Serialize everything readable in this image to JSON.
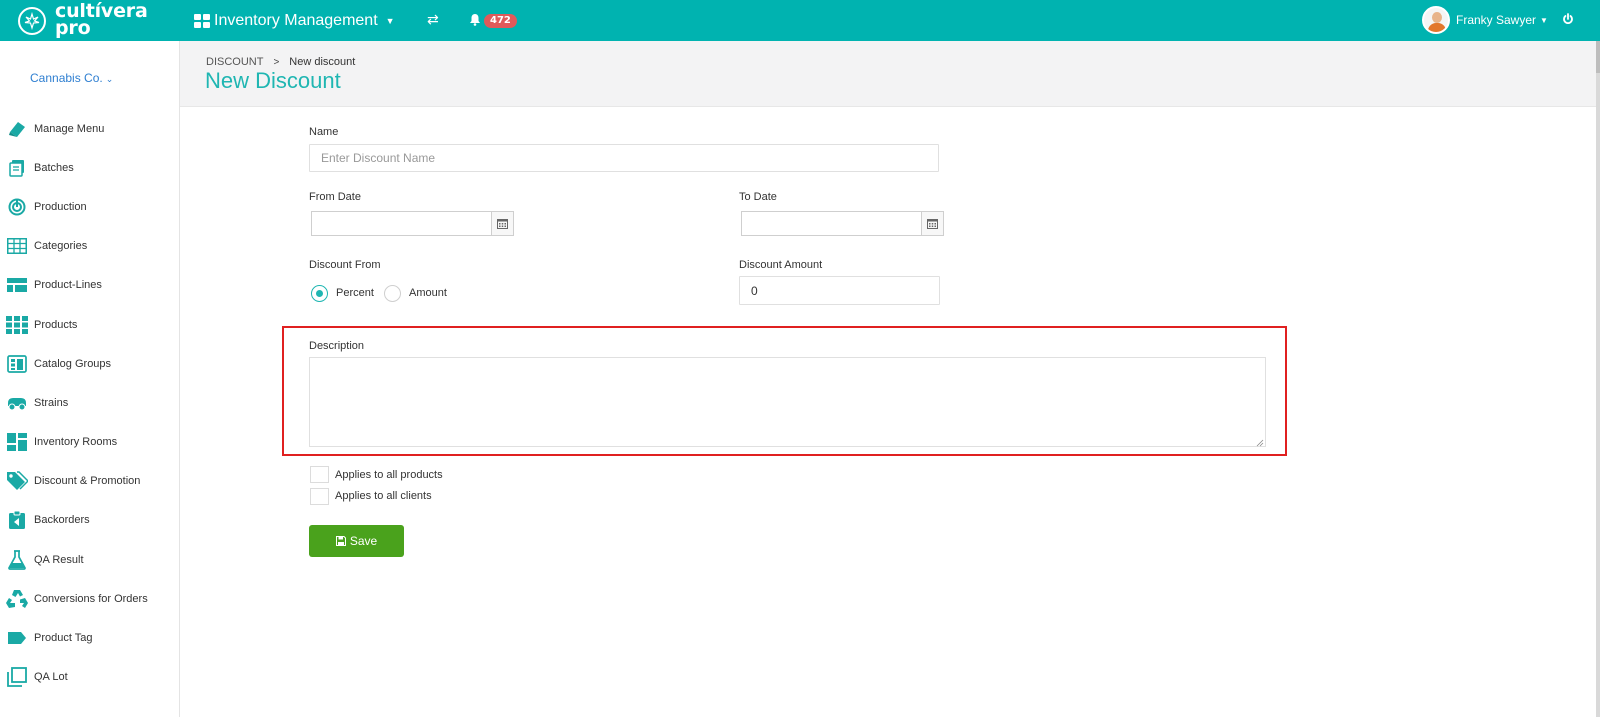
{
  "topbar": {
    "logo_line1": "cultívera",
    "logo_line2": "pro",
    "module_title": "Inventory Management",
    "notifications_count": "472",
    "user_name": "Franky Sawyer"
  },
  "sidebar": {
    "company": "Cannabis Co.",
    "items": [
      {
        "label": "Manage Menu",
        "icon": "menu-book-icon"
      },
      {
        "label": "Batches",
        "icon": "batches-icon"
      },
      {
        "label": "Production",
        "icon": "production-icon"
      },
      {
        "label": "Categories",
        "icon": "categories-grid-icon"
      },
      {
        "label": "Product-Lines",
        "icon": "product-lines-icon"
      },
      {
        "label": "Products",
        "icon": "products-grid-icon"
      },
      {
        "label": "Catalog Groups",
        "icon": "catalog-groups-icon"
      },
      {
        "label": "Strains",
        "icon": "strains-icon"
      },
      {
        "label": "Inventory Rooms",
        "icon": "inventory-rooms-icon"
      },
      {
        "label": "Discount & Promotion",
        "icon": "tags-icon"
      },
      {
        "label": "Backorders",
        "icon": "backorders-icon"
      },
      {
        "label": "QA Result",
        "icon": "flask-icon"
      },
      {
        "label": "Conversions for Orders",
        "icon": "recycle-icon"
      },
      {
        "label": "Product Tag",
        "icon": "tag-icon"
      },
      {
        "label": "QA Lot",
        "icon": "qa-lot-icon"
      }
    ]
  },
  "header": {
    "breadcrumb_root": "DISCOUNT",
    "breadcrumb_current": "New discount",
    "title": "New Discount"
  },
  "form": {
    "name_label": "Name",
    "name_placeholder": "Enter Discount Name",
    "name_value": "",
    "from_date_label": "From Date",
    "from_date_value": "",
    "to_date_label": "To Date",
    "to_date_value": "",
    "discount_from_label": "Discount From",
    "discount_from_options": [
      "Percent",
      "Amount"
    ],
    "discount_from_selected": "Percent",
    "discount_amount_label": "Discount Amount",
    "discount_amount_value": "0",
    "description_label": "Description",
    "description_value": "",
    "applies_products_label": "Applies to all products",
    "applies_products_checked": false,
    "applies_clients_label": "Applies to all clients",
    "applies_clients_checked": false,
    "save_label": "Save"
  },
  "colors": {
    "brand_teal": "#00b3b0",
    "title_teal": "#1fb6b2",
    "save_green": "#4aa21c",
    "highlight_red": "#e02020",
    "badge_red": "#e05a5a"
  }
}
